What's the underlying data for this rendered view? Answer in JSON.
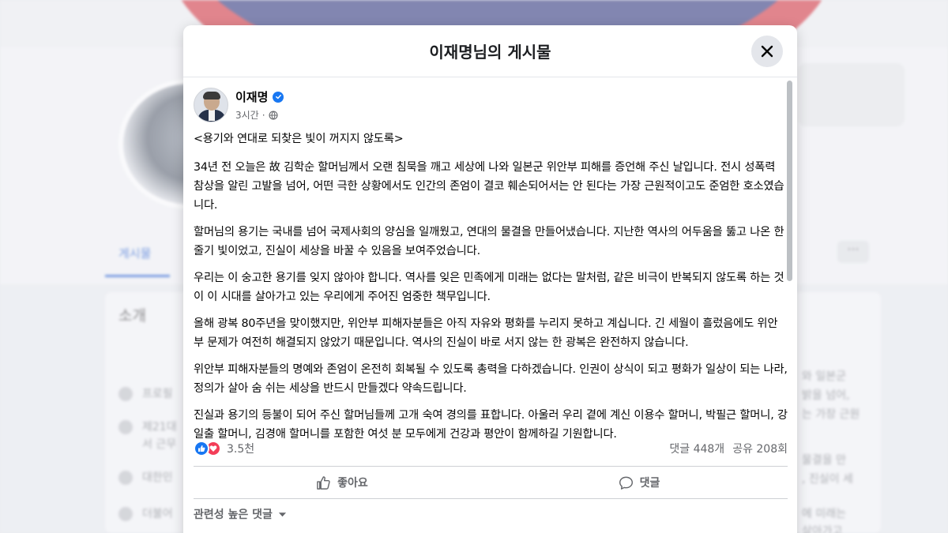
{
  "background": {
    "tab_label": "게시물",
    "more_label": "···",
    "intro_title": "소개",
    "intro_items": [
      {
        "label": "프로필"
      },
      {
        "label": "제21대"
      },
      {
        "label": "서 근무"
      },
      {
        "label": "대한민"
      },
      {
        "label": "더불어"
      }
    ],
    "right_snippets": [
      "와 일본군",
      "밝을 넘어,",
      "는 가장 근원",
      "물결을 만",
      ", 진실이 세",
      "에 미래는",
      "살아가고"
    ]
  },
  "modal": {
    "title": "이재명님의 게시물",
    "close_icon": "close-icon"
  },
  "post": {
    "author": "이재명",
    "time": "3시간",
    "meta_sep": "·",
    "paragraphs": [
      "<용기와 연대로 되찾은 빛이 꺼지지 않도록>",
      "34년 전 오늘은 故 김학순 할머님께서 오랜 침묵을 깨고 세상에 나와 일본군 위안부 피해를 증언해 주신 날입니다. 전시 성폭력 참상을 알린 고발을 넘어, 어떤 극한 상황에서도 인간의 존엄이 결코 훼손되어서는 안 된다는 가장 근원적이고도 준엄한 호소였습니다.",
      "할머님의 용기는 국내를 넘어 국제사회의 양심을 일깨웠고, 연대의 물결을 만들어냈습니다. 지난한 역사의 어두움을 뚫고 나온 한 줄기 빛이었고, 진실이 세상을 바꿀 수 있음을 보여주었습니다.",
      "우리는 이 숭고한 용기를 잊지 않아야 합니다. 역사를 잊은 민족에게 미래는 없다는 말처럼, 같은 비극이 반복되지 않도록 하는 것이 이 시대를 살아가고 있는 우리에게 주어진 엄중한 책무입니다.",
      "올해 광복 80주년을 맞이했지만, 위안부 피해자분들은 아직 자유와 평화를 누리지 못하고 계십니다. 긴 세월이 흘렀음에도 위안부 문제가 여전히 해결되지 않았기 때문입니다. 역사의 진실이 바로 서지 않는 한 광복은 완전하지 않습니다.",
      "위안부 피해자분들의 명예와 존엄이 온전히 회복될 수 있도록 총력을 다하겠습니다. 인권이 상식이 되고 평화가 일상이 되는 나라, 정의가 살아 숨 쉬는 세상을 반드시 만들겠다 약속드립니다.",
      "진실과 용기의 등불이 되어 주신 할머님들께 고개 숙여 경의를 표합니다. 아울러 우리 곁에 계신 이용수 할머니, 박필근 할머니, 강일출 할머니, 김경애 할머니를 포함한 여섯 분 모두에게 건강과 평안이 함께하길 기원합니다."
    ],
    "reaction_count": "3.5천",
    "comments": "댓글 448개",
    "shares": "공유 208회",
    "like_label": "좋아요",
    "comment_label": "댓글",
    "sort_label": "관련성 높은 댓글"
  },
  "colors": {
    "accent": "#1877f2",
    "love": "#f33e58"
  }
}
